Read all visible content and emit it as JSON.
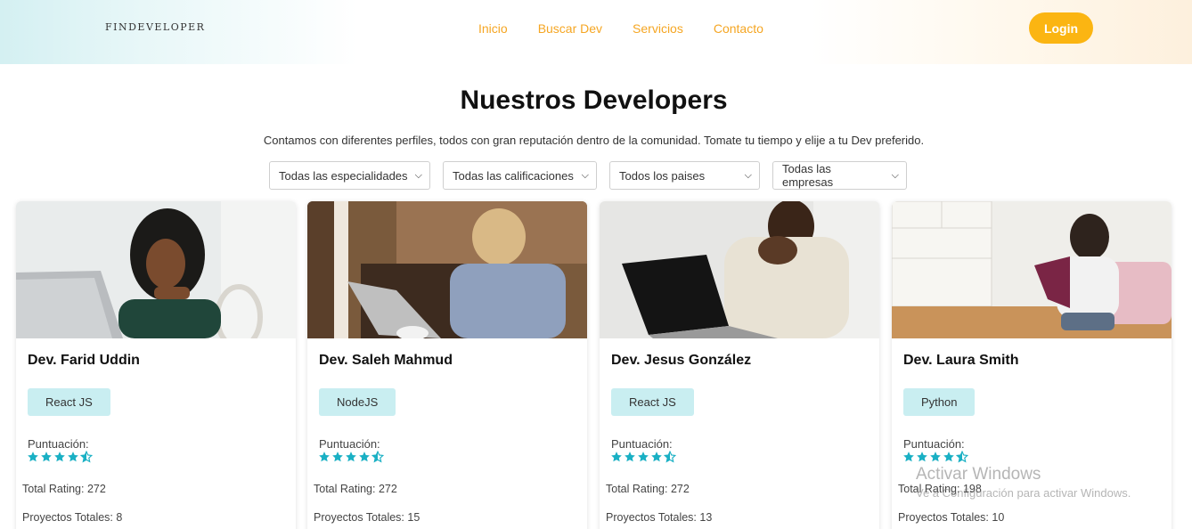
{
  "header": {
    "logo": "FINDEVELOPER",
    "nav": [
      "Inicio",
      "Buscar Dev",
      "Servicios",
      "Contacto"
    ],
    "login_label": "Login"
  },
  "main": {
    "title": "Nuestros Developers",
    "subtitle": "Contamos con diferentes perfiles, todos con gran reputación dentro de la comunidad. Tomate tu tiempo y elije a tu Dev preferido.",
    "filters": [
      "Todas las especialidades",
      "Todas las calificaciones",
      "Todos los paises",
      "Todas las empresas"
    ]
  },
  "score_label": "Puntuación:",
  "total_rating_prefix": "Total Rating: ",
  "projects_prefix": "Proyectos Totales: ",
  "cards": [
    {
      "name": "Dev. Farid Uddin",
      "tag": "React JS",
      "rating_stars": 4.5,
      "total_rating": "Total Rating: 272",
      "projects": "Proyectos Totales: 8"
    },
    {
      "name": "Dev. Saleh Mahmud",
      "tag": "NodeJS",
      "rating_stars": 4.5,
      "total_rating": "Total Rating: 272",
      "projects": "Proyectos Totales: 15"
    },
    {
      "name": "Dev. Jesus González",
      "tag": "React JS",
      "rating_stars": 4.5,
      "total_rating": "Total Rating: 272",
      "projects": "Proyectos Totales: 13"
    },
    {
      "name": "Dev. Laura Smith",
      "tag": "Python",
      "rating_stars": 4.5,
      "total_rating": "Total Rating: 198",
      "projects": "Proyectos Totales: 10"
    }
  ],
  "colors": {
    "accent": "#f5a623",
    "login_bg": "#fbb512",
    "tag_bg": "#c9eef1",
    "star": "#1ab0c4"
  },
  "watermark": {
    "line1": "Activar Windows",
    "line2": "Ve a Configuración para activar Windows."
  }
}
